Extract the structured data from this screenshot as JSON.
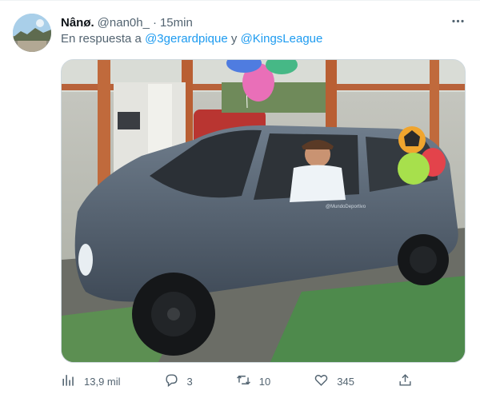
{
  "tweet": {
    "display_name": "Nânø.",
    "handle": "@nan0h_",
    "separator": "·",
    "time": "15min",
    "reply_prefix": "En respuesta a",
    "mention_1": "@3gerardpique",
    "reply_joiner": "y",
    "mention_2": "@KingsLeague",
    "media_label": "@MundoDeportivo"
  },
  "actions": {
    "views": "13,9 mil",
    "replies": "3",
    "retweets": "10",
    "likes": "345"
  },
  "icons": {
    "more": "more-horizontal-icon",
    "views": "analytics-icon",
    "reply": "reply-icon",
    "retweet": "retweet-icon",
    "like": "heart-icon",
    "share": "share-icon"
  },
  "colors": {
    "accent": "#1d9bf0",
    "secondary_text": "#536471",
    "border": "#cfd9de"
  }
}
